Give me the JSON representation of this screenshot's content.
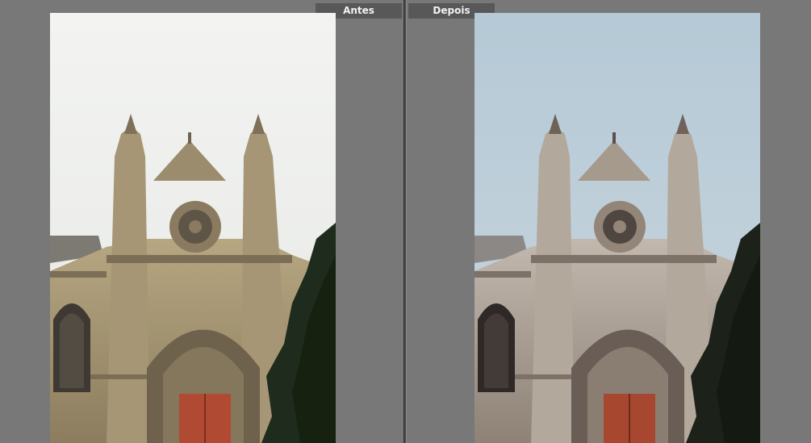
{
  "compare": {
    "before_label": "Antes",
    "after_label": "Depois"
  },
  "colors": {
    "workspace": "#787878",
    "label_bg": "#585858",
    "label_text": "#f2f2f2",
    "divider": "#4a4a4a",
    "before_sky": "#eef0ee",
    "after_sky": "#b9ccd8",
    "before_stone": "#a8997a",
    "after_stone": "#b6aca1",
    "door": "#b04a33",
    "tree": "#1f2b1c"
  }
}
